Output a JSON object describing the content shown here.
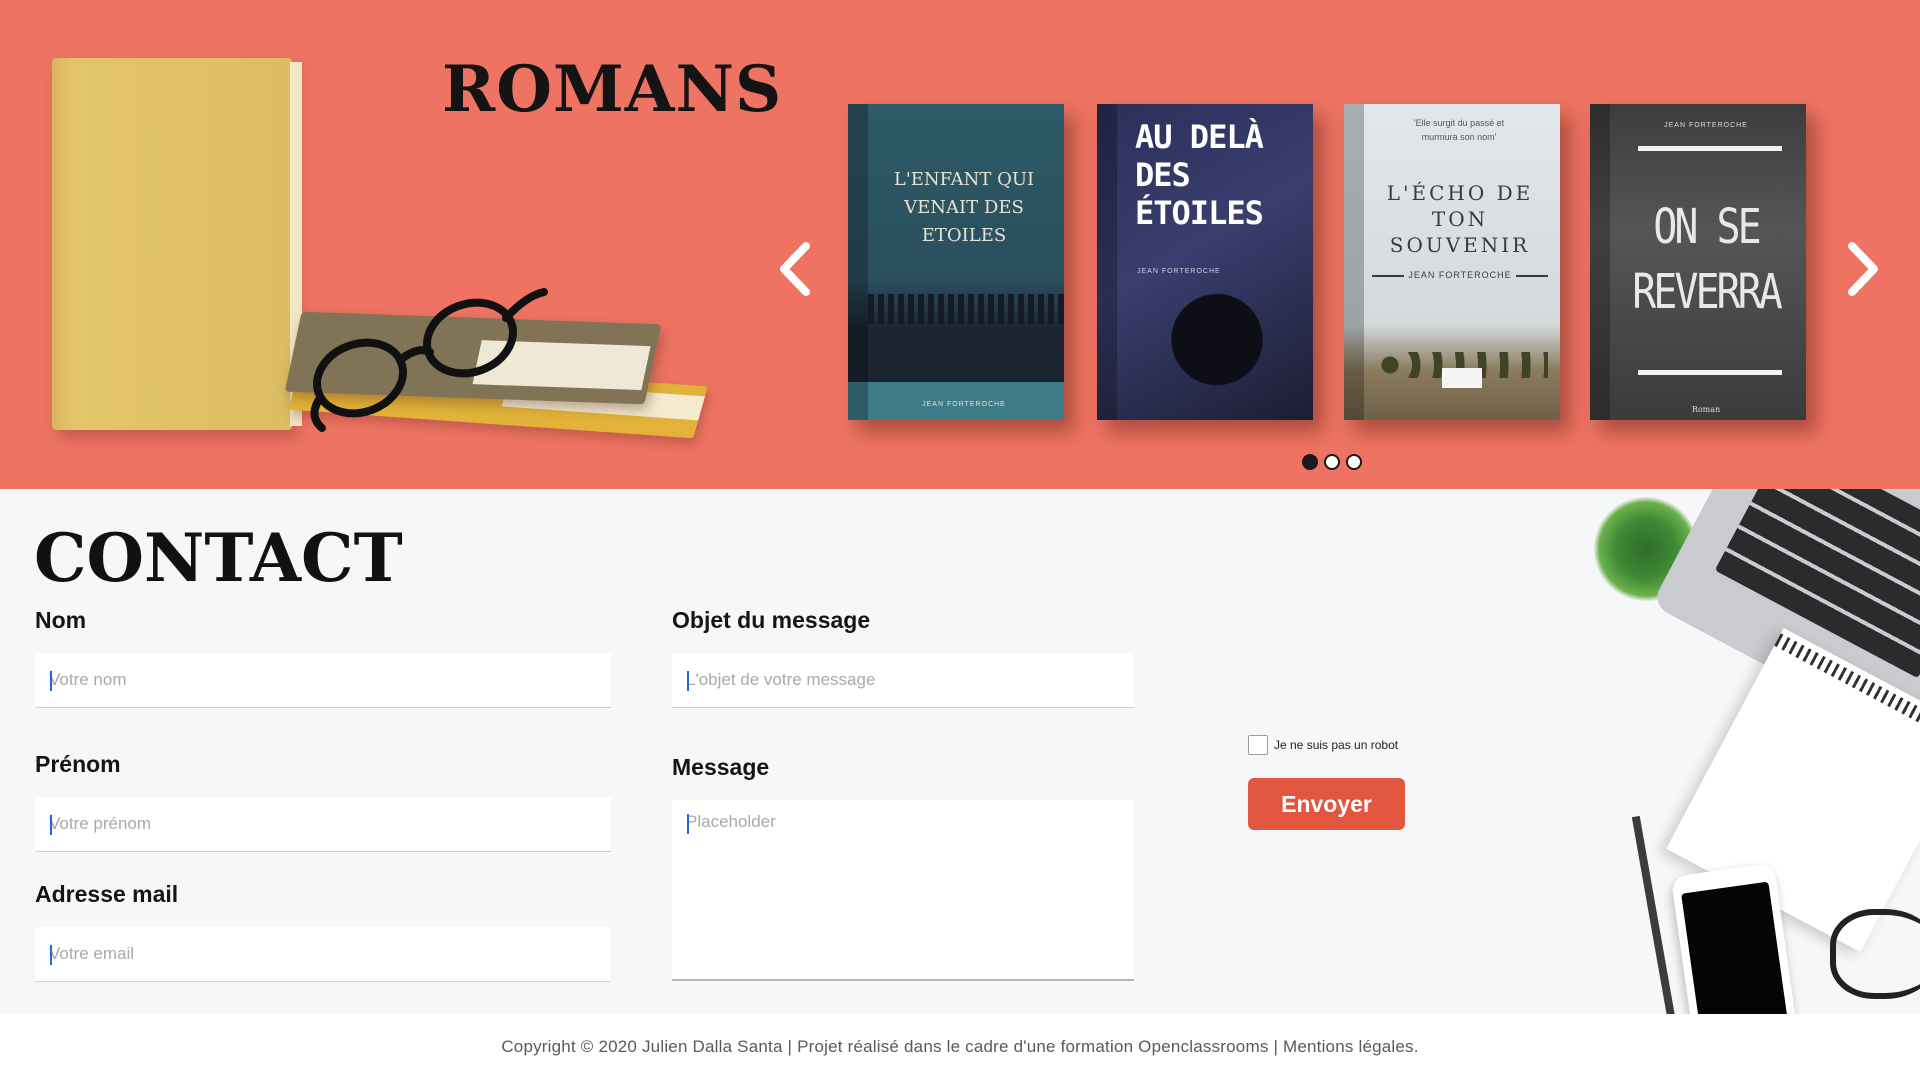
{
  "hero": {
    "title": "ROMANS",
    "carousel": {
      "books": [
        {
          "title": "L'ENFANT QUI\nVENAIT DES\nETOILES",
          "author": "JEAN FORTEROCHE"
        },
        {
          "title": "AU DELÀ\nDES\nÉTOILES",
          "author": "JEAN FORTEROCHE"
        },
        {
          "quote": "'Elle surgit du passé et\nmurmura son nom'",
          "title": "L'ÉCHO DE\nTON\nSOUVENIR",
          "author": "JEAN FORTEROCHE"
        },
        {
          "author": "JEAN FORTEROCHE",
          "title": "ON SE\nREVERRA",
          "genre": "Roman"
        }
      ],
      "prev_icon": "chevron-left-icon",
      "next_icon": "chevron-right-icon",
      "active_slide": 1,
      "slide_count": 3
    }
  },
  "contact": {
    "title": "CONTACT",
    "nom": {
      "label": "Nom",
      "placeholder": "Votre nom"
    },
    "prenom": {
      "label": "Prénom",
      "placeholder": "Votre prénom"
    },
    "email": {
      "label": "Adresse mail",
      "placeholder": "Votre email"
    },
    "objet": {
      "label": "Objet du message",
      "placeholder": "L'objet de votre message"
    },
    "message": {
      "label": "Message",
      "placeholder": "Placeholder"
    },
    "captcha_label": "Je ne suis pas un robot",
    "submit_label": "Envoyer"
  },
  "footer": {
    "text": "Copyright © 2020 Julien Dalla Santa | Projet réalisé dans le cadre d'une formation Openclassrooms | Mentions légales."
  },
  "colors": {
    "hero_bg": "#ee7362",
    "button_bg": "#e2553f",
    "contact_bg": "#f6f7f9"
  }
}
